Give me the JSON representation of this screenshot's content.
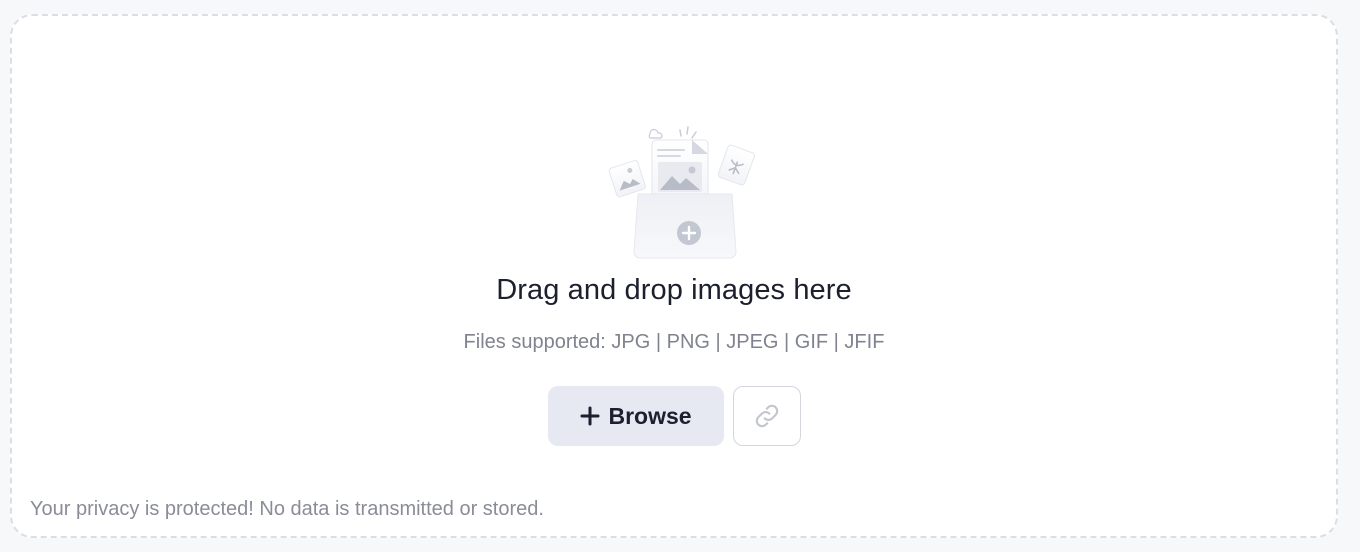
{
  "dropzone": {
    "headline": "Drag and drop images here",
    "supported_formats": "Files supported: JPG | PNG | JPEG | GIF | JFIF",
    "illustration_icon": "folder-with-images-illustration"
  },
  "actions": {
    "browse_label": "Browse",
    "browse_icon": "plus-icon",
    "link_icon": "link-icon"
  },
  "footer": {
    "privacy_text": "Your privacy is protected! No data is transmitted or stored."
  },
  "colors": {
    "accent_button_bg": "#e6e9f2",
    "text_primary": "#1c1f2e",
    "text_muted": "#80838f",
    "border_dashed": "#dcdee6"
  }
}
